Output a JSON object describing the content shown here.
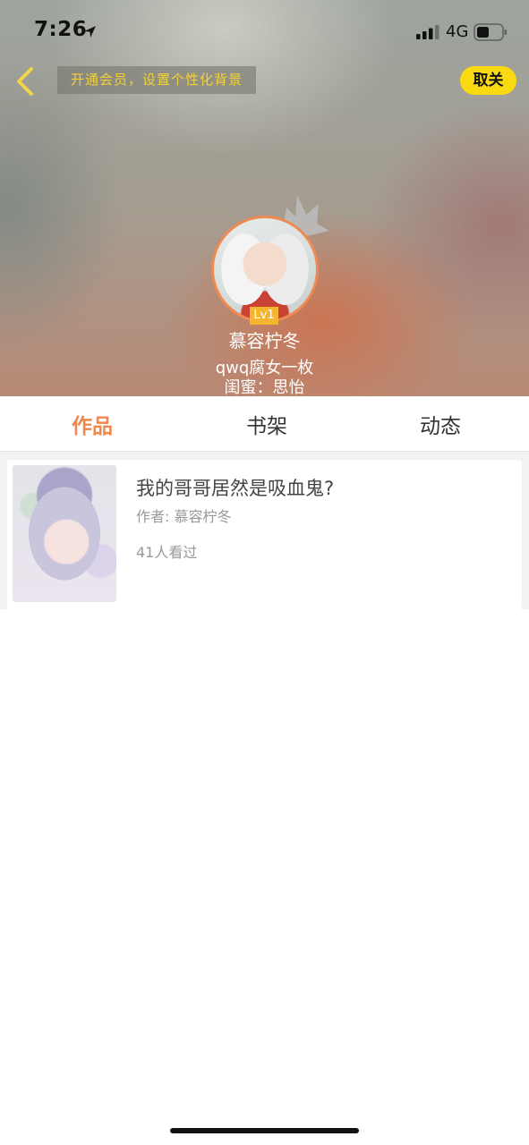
{
  "status_bar": {
    "time": "7:26",
    "network": "4G",
    "icons": [
      "location-arrow-icon",
      "signal-icon",
      "battery-icon"
    ]
  },
  "header": {
    "vip_banner": "开通会员，设置个性化背景",
    "follow_label": "取关",
    "level": "Lv1",
    "nickname": "慕容柠冬",
    "signature": "qwq腐女一枚",
    "bestie": "闺蜜：思怡",
    "icons": [
      "back-icon",
      "crown-icon"
    ]
  },
  "tabs": [
    {
      "label": "作品",
      "active": true
    },
    {
      "label": "书架",
      "active": false
    },
    {
      "label": "动态",
      "active": false
    }
  ],
  "works": [
    {
      "title": "我的哥哥居然是吸血鬼?",
      "author": "作者: 慕容柠冬",
      "views": "41人看过"
    }
  ],
  "colors": {
    "accent": "#f0874d",
    "follow_button": "#f8d912",
    "vip_text": "#f2d13a",
    "level_badge": "#f5b52e"
  }
}
